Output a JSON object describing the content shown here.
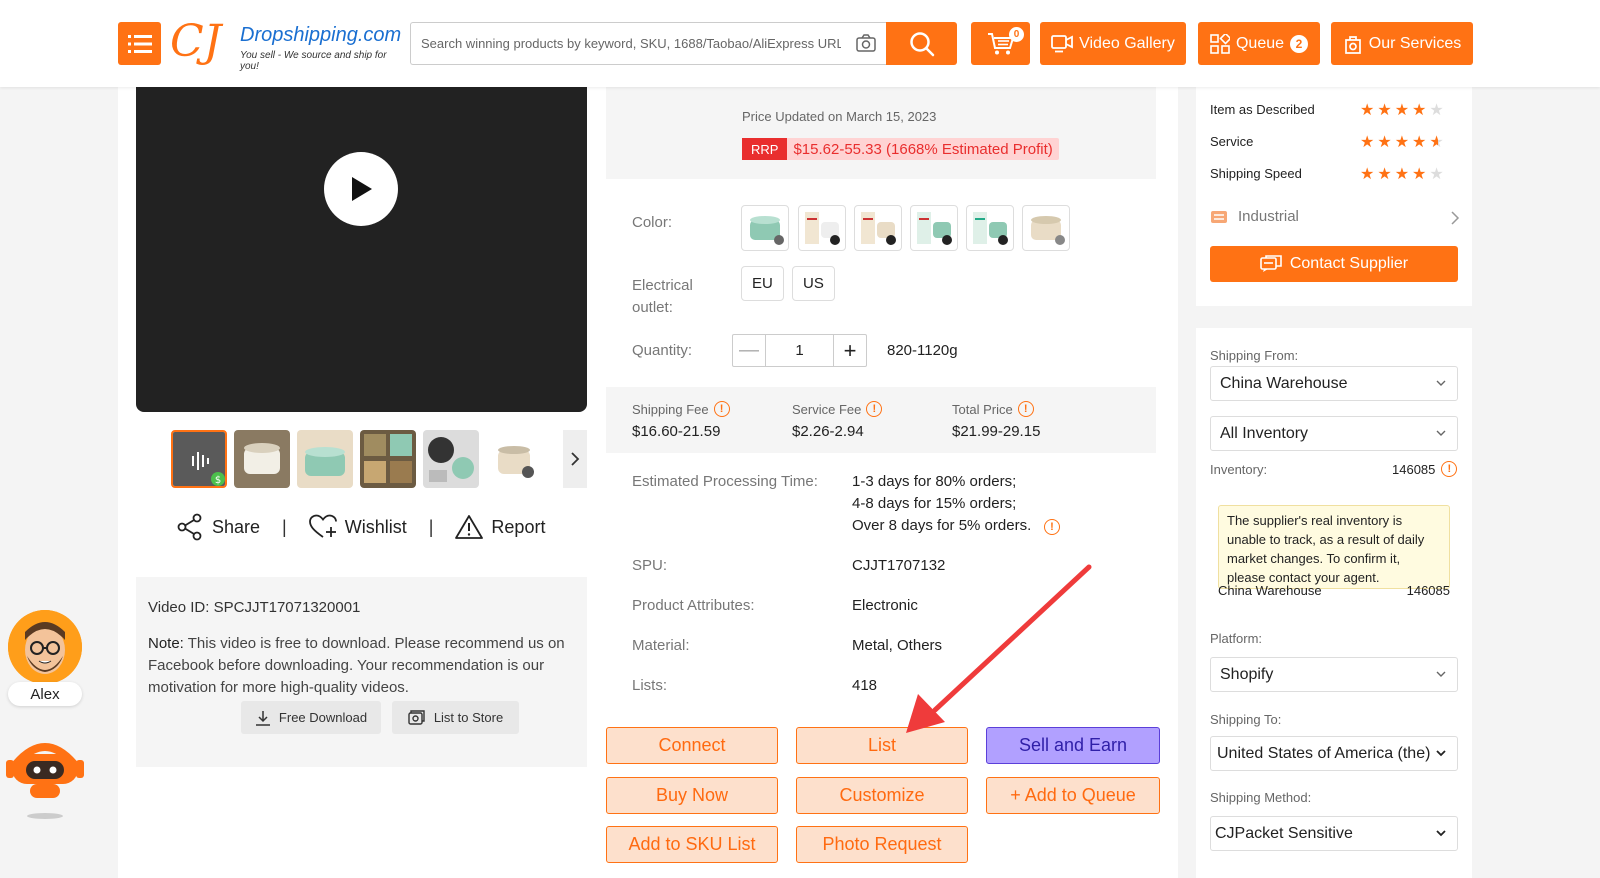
{
  "header": {
    "logo_name": "Dropshipping.com",
    "logo_tagline": "You sell - We source and ship for you!",
    "search_placeholder": "Search winning products by keyword, SKU, 1688/Taobao/AliExpress URL",
    "cart_count": "0",
    "video_gallery": "Video Gallery",
    "queue": "Queue",
    "queue_count": "2",
    "our_services": "Our Services"
  },
  "media": {
    "share": "Share",
    "wishlist": "Wishlist",
    "report": "Report",
    "separator": "|",
    "video_id_label": "Video ID:",
    "video_id": "SPCJJT17071320001",
    "note_label": "Note:",
    "note_text": "This video is free to download. Please recommend us on Facebook before downloading. Your recommendation is our motivation for more high-quality videos.",
    "free_download": "Free Download",
    "list_to_store": "List to Store"
  },
  "product": {
    "price_updated": "Price Updated on March 15, 2023",
    "rrp_tag": "RRP",
    "rrp_value": "$15.62-55.33 (1668% Estimated Profit)",
    "color_label": "Color:",
    "outlet_label": "Electrical outlet:",
    "outlets": [
      "EU",
      "US"
    ],
    "quantity_label": "Quantity:",
    "quantity": "1",
    "minus": "—",
    "plus": "+",
    "weight": "820-1120g",
    "shipping_fee_label": "Shipping Fee",
    "shipping_fee": "$16.60-21.59",
    "service_fee_label": "Service Fee",
    "service_fee": "$2.26-2.94",
    "total_price_label": "Total Price",
    "total_price": "$21.99-29.15",
    "processing_label": "Estimated Processing Time:",
    "processing": [
      "1-3 days for 80% orders;",
      "4-8 days for 15% orders;",
      "Over 8 days for 5% orders."
    ],
    "spu_label": "SPU:",
    "spu": "CJJT1707132",
    "attributes_label": "Product Attributes:",
    "attributes": "Electronic",
    "material_label": "Material:",
    "material": "Metal, Others",
    "lists_label": "Lists:",
    "lists": "418"
  },
  "buttons": {
    "connect": "Connect",
    "list": "List",
    "sell_and_earn": "Sell and Earn",
    "buy_now": "Buy Now",
    "customize": "Customize",
    "add_to_queue": "+ Add to Queue",
    "add_to_sku_list": "Add to SKU List",
    "photo_request": "Photo Request"
  },
  "supplier": {
    "ratings": [
      {
        "label": "Item as Described",
        "stars": 4
      },
      {
        "label": "Service",
        "stars": 4.5
      },
      {
        "label": "Shipping Speed",
        "stars": 4
      }
    ],
    "industrial": "Industrial",
    "contact_supplier": "Contact Supplier"
  },
  "shipping": {
    "from_label": "Shipping From:",
    "from_value": "China Warehouse",
    "inventory_filter": "All Inventory",
    "inventory_label": "Inventory:",
    "inventory_value": "146085",
    "tip": "The supplier's real inventory is unable to track, as a result of daily market changes. To confirm it, please contact your agent.",
    "warehouse_name": "China Warehouse",
    "warehouse_count": "146085",
    "platform_label": "Platform:",
    "platform_value": "Shopify",
    "to_label": "Shipping To:",
    "to_value": "United States of America (the)",
    "method_label": "Shipping Method:",
    "method_value": "CJPacket Sensitive"
  },
  "agent": {
    "name": "Alex"
  },
  "colors": {
    "accent": "#ff7214",
    "rrp_red": "#e92e2e",
    "purple": "#b1a0ff",
    "arrow": "#ef3b3b"
  }
}
